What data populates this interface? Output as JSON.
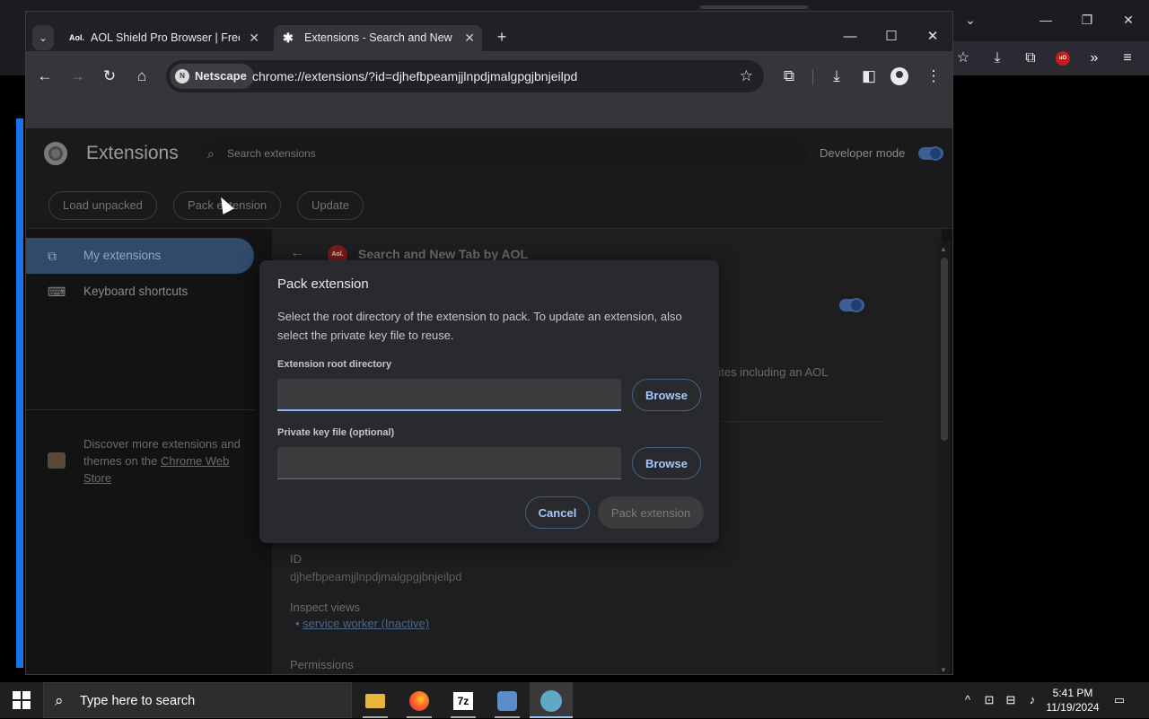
{
  "background_browser": {
    "window_controls": [
      "⌄",
      "—",
      "❐",
      "✕"
    ],
    "toolbar_icons": [
      "star-icon",
      "download-icon",
      "extensions-icon",
      "ublock-icon",
      "overflow-icon",
      "menu-icon"
    ],
    "ublock_label": "uO"
  },
  "tabs": {
    "tab_search": "⌄",
    "items": [
      {
        "icon": "Aol.",
        "label": "AOL Shield Pro Browser | Free",
        "active": false
      },
      {
        "icon": "✱",
        "label": "Extensions - Search and New Tab",
        "active": true
      }
    ],
    "new_tab": "+",
    "close": "✕"
  },
  "window_controls": {
    "minimize": "—",
    "maximize": "☐",
    "close": "✕"
  },
  "toolbar": {
    "site_chip": "Netscape",
    "site_chip_icon": "N",
    "url": "chrome://extensions/?id=djhefbpeamjjlnpdjmalgpgjbnjeilpd"
  },
  "extensions_page": {
    "title": "Extensions",
    "search_placeholder": "Search extensions",
    "developer_mode_label": "Developer mode",
    "developer_mode": true,
    "actions": [
      "Load unpacked",
      "Pack extension",
      "Update"
    ],
    "sidebar": {
      "items": [
        {
          "label": "My extensions",
          "selected": true
        },
        {
          "label": "Keyboard shortcuts",
          "selected": false
        }
      ],
      "discover_text": "Discover more extensions and themes on the",
      "discover_link": "Chrome Web Store"
    },
    "detail": {
      "extension_name": "Search and New Tab by AOL",
      "icon_label": "Aol.",
      "enabled": true,
      "description_fragment": "p sites including an AOL",
      "id_label": "ID",
      "id_value": "djhefbpeamjjlnpdjmalgpgjbnjeilpd",
      "inspect_label": "Inspect views",
      "inspect_link": "service worker (Inactive)",
      "permissions_label": "Permissions"
    }
  },
  "dialog": {
    "title": "Pack extension",
    "description": "Select the root directory of the extension to pack. To update an extension, also select the private key file to reuse.",
    "root_label": "Extension root directory",
    "root_value": "",
    "key_label": "Private key file (optional)",
    "key_value": "",
    "browse": "Browse",
    "cancel": "Cancel",
    "pack": "Pack extension"
  },
  "taskbar": {
    "search_placeholder": "Type here to search",
    "apps": [
      "file-explorer-icon",
      "firefox-icon",
      "7zip-icon",
      "network-app-icon",
      "netscape-icon"
    ],
    "z7_label": "7z",
    "time": "5:41 PM",
    "date": "11/19/2024"
  }
}
